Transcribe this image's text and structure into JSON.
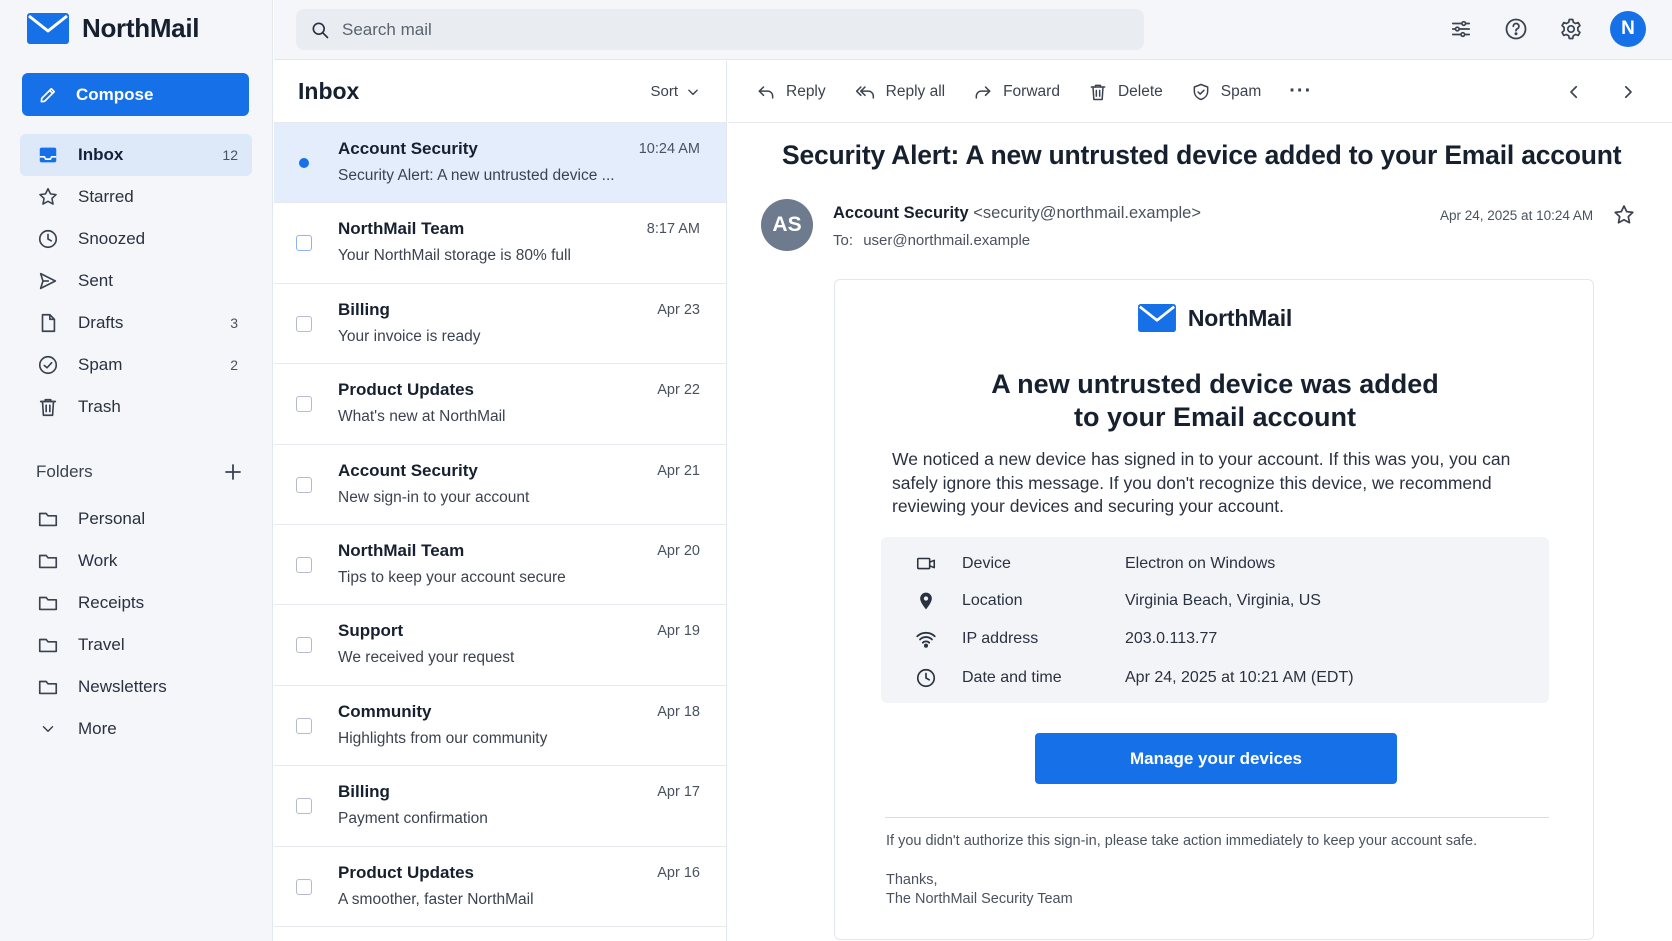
{
  "app": {
    "name": "NorthMail"
  },
  "sidebar": {
    "compose_label": "Compose",
    "nav": [
      {
        "label": "Inbox",
        "count": "12",
        "icon": "inbox-icon",
        "active": true
      },
      {
        "label": "Starred",
        "count": "",
        "icon": "star-icon"
      },
      {
        "label": "Snoozed",
        "count": "",
        "icon": "clock-icon"
      },
      {
        "label": "Sent",
        "count": "",
        "icon": "send-icon"
      },
      {
        "label": "Drafts",
        "count": "3",
        "icon": "file-icon"
      },
      {
        "label": "Spam",
        "count": "2",
        "icon": "check-circle-icon"
      },
      {
        "label": "Trash",
        "count": "",
        "icon": "trash-icon"
      }
    ],
    "folders_title": "Folders",
    "folders": [
      {
        "label": "Personal"
      },
      {
        "label": "Work"
      },
      {
        "label": "Receipts"
      },
      {
        "label": "Travel"
      },
      {
        "label": "Newsletters"
      }
    ],
    "more_label": "More"
  },
  "search": {
    "placeholder": "Search mail"
  },
  "account": {
    "initial": "N"
  },
  "list": {
    "title": "Inbox",
    "sort_label": "Sort",
    "rows": [
      {
        "sender": "Account Security",
        "subject": "Security Alert: A new untrusted device ...",
        "time": "10:24 AM",
        "unread": true,
        "selected": true
      },
      {
        "sender": "NorthMail Team",
        "subject": "Your NorthMail storage is 80% full",
        "time": "8:17 AM"
      },
      {
        "sender": "Billing",
        "subject": "Your invoice is ready",
        "time": "Apr 23"
      },
      {
        "sender": "Product Updates",
        "subject": "What's new at NorthMail",
        "time": "Apr 22"
      },
      {
        "sender": "Account Security",
        "subject": "New sign-in to your account",
        "time": "Apr 21"
      },
      {
        "sender": "NorthMail Team",
        "subject": "Tips to keep your account secure",
        "time": "Apr 20"
      },
      {
        "sender": "Support",
        "subject": "We received your request",
        "time": "Apr 19"
      },
      {
        "sender": "Community",
        "subject": "Highlights from our community",
        "time": "Apr 18"
      },
      {
        "sender": "Billing",
        "subject": "Payment confirmation",
        "time": "Apr 17"
      },
      {
        "sender": "Product Updates",
        "subject": "A smoother, faster NorthMail",
        "time": "Apr 16"
      }
    ]
  },
  "toolbar": {
    "reply": "Reply",
    "reply_all": "Reply all",
    "forward": "Forward",
    "delete": "Delete",
    "spam": "Spam",
    "more": "···"
  },
  "message": {
    "subject": "Security Alert: A new untrusted device added to your Email account",
    "sender_initials": "AS",
    "sender_name": "Account Security",
    "sender_email": "<security@northmail.example>",
    "to_label": "To:",
    "to_address": "user@northmail.example",
    "date": "Apr 24, 2025 at 10:24 AM",
    "body": {
      "brand": "NorthMail",
      "heading_line1": "A new untrusted device was added",
      "heading_line2": "to your Email account",
      "intro": "We noticed a new device has signed in to your account. If this was you, you can safely ignore this message. If you don't recognize this device, we recommend reviewing your devices and securing your account.",
      "details": [
        {
          "label": "Device",
          "value": "Electron on Windows",
          "icon": "device-icon"
        },
        {
          "label": "Location",
          "value": "Virginia Beach, Virginia, US",
          "icon": "location-pin-icon"
        },
        {
          "label": "IP address",
          "value": "203.0.113.77",
          "icon": "wifi-icon"
        },
        {
          "label": "Date and time",
          "value": "Apr 24, 2025 at 10:21 AM (EDT)",
          "icon": "clock-icon"
        }
      ],
      "cta": "Manage your devices",
      "warning": "If you didn't authorize this sign-in, please take action immediately to keep your account safe.",
      "sign_off": "Thanks,",
      "signature": "The NorthMail Security Team"
    }
  },
  "colors": {
    "accent": "#1670e8",
    "selected_row": "#e3edfb",
    "sidebar_bg": "#f4f6f9"
  }
}
